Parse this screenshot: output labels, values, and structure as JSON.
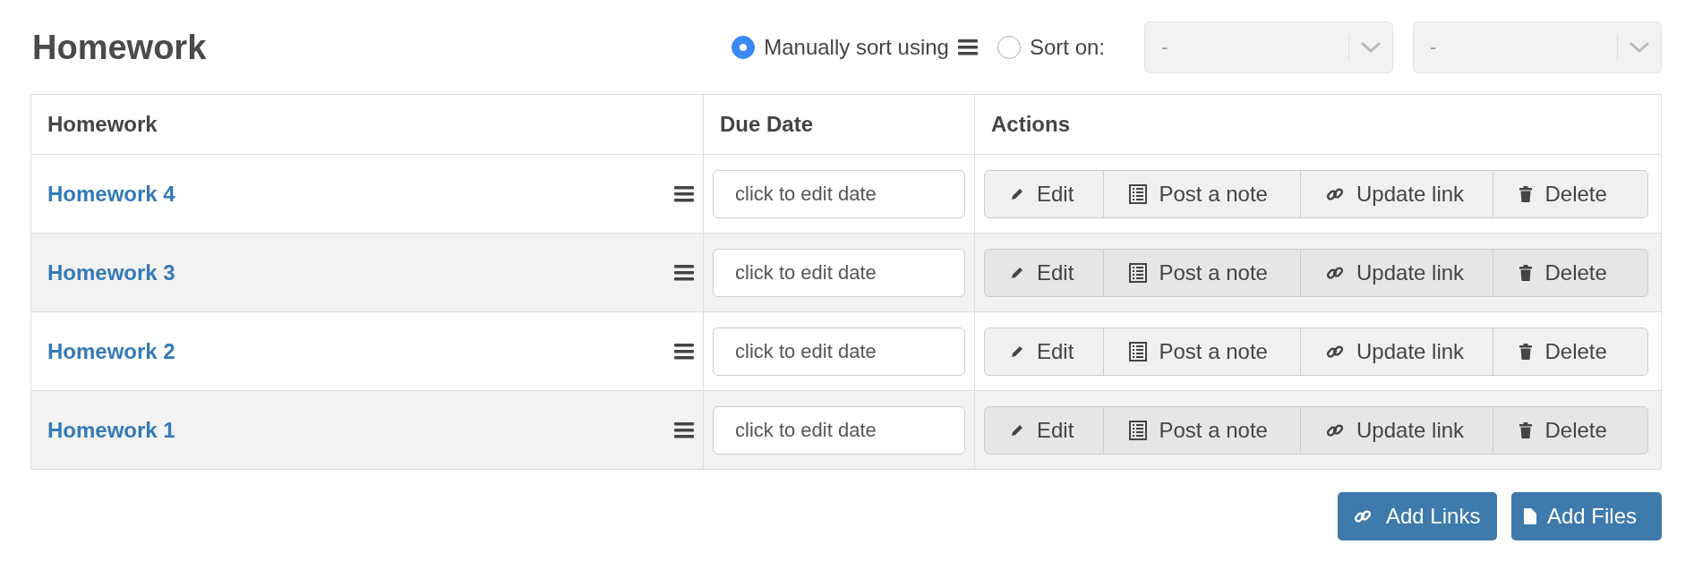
{
  "title": "Homework",
  "sort": {
    "options": [
      {
        "label": "Manually sort using",
        "selected": true,
        "kind": "manual"
      },
      {
        "label": "Sort on:",
        "selected": false,
        "kind": "field"
      }
    ],
    "dropdowns": [
      {
        "value": "-"
      },
      {
        "value": "-"
      }
    ]
  },
  "table": {
    "columns": [
      "Homework",
      "Due Date",
      "Actions"
    ],
    "rows": [
      {
        "name": "Homework 4",
        "due_placeholder": "click to edit date",
        "actions": [
          {
            "label": "Edit",
            "kind": "edit"
          },
          {
            "label": "Post a note",
            "kind": "note"
          },
          {
            "label": "Update link",
            "kind": "link"
          },
          {
            "label": "Delete",
            "kind": "delete"
          }
        ]
      },
      {
        "name": "Homework 3",
        "due_placeholder": "click to edit date",
        "actions": [
          {
            "label": "Edit",
            "kind": "edit"
          },
          {
            "label": "Post a note",
            "kind": "note"
          },
          {
            "label": "Update link",
            "kind": "link"
          },
          {
            "label": "Delete",
            "kind": "delete"
          }
        ]
      },
      {
        "name": "Homework 2",
        "due_placeholder": "click to edit date",
        "actions": [
          {
            "label": "Edit",
            "kind": "edit"
          },
          {
            "label": "Post a note",
            "kind": "note"
          },
          {
            "label": "Update link",
            "kind": "link"
          },
          {
            "label": "Delete",
            "kind": "delete"
          }
        ]
      },
      {
        "name": "Homework 1",
        "due_placeholder": "click to edit date",
        "actions": [
          {
            "label": "Edit",
            "kind": "edit"
          },
          {
            "label": "Post a note",
            "kind": "note"
          },
          {
            "label": "Update link",
            "kind": "link"
          },
          {
            "label": "Delete",
            "kind": "delete"
          }
        ]
      }
    ]
  },
  "buttons": [
    {
      "label": "Add Links",
      "kind": "link"
    },
    {
      "label": "Add Files",
      "kind": "file"
    }
  ]
}
